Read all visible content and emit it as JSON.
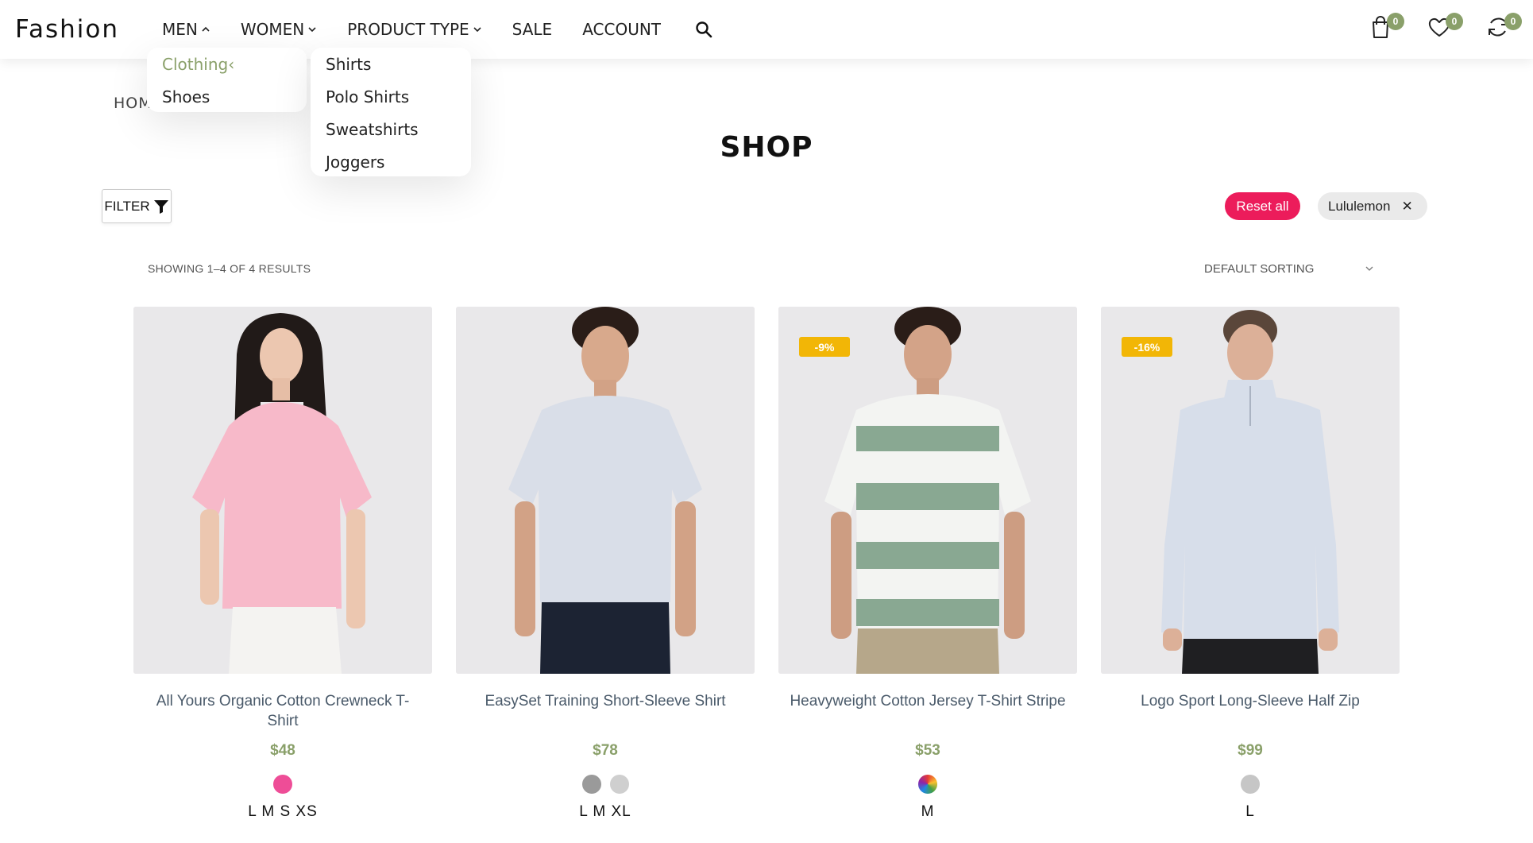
{
  "header": {
    "logo": "Fashion",
    "nav": [
      {
        "label": "MEN",
        "chevron": "up"
      },
      {
        "label": "WOMEN",
        "chevron": "down"
      },
      {
        "label": "PRODUCT TYPE",
        "chevron": "down"
      },
      {
        "label": "SALE"
      },
      {
        "label": "ACCOUNT"
      }
    ],
    "icons": {
      "cart_count": "0",
      "wishlist_count": "0",
      "compare_count": "0"
    }
  },
  "menu": {
    "categories": [
      {
        "label": "Clothing",
        "suffix": "‹",
        "active": true
      },
      {
        "label": "Shoes"
      }
    ],
    "subcategories": [
      "Shirts",
      "Polo Shirts",
      "Sweatshirts",
      "Joggers"
    ]
  },
  "breadcrumb": "HOM",
  "page_title": "SHOP",
  "toolbar": {
    "filter_label": "FILTER",
    "reset_label": "Reset all",
    "active_filter": "Lululemon",
    "results_text": "SHOWING 1–4 OF 4 RESULTS",
    "sorting_label": "DEFAULT SORTING"
  },
  "colors": {
    "accent": "#8aa06a",
    "reset": "#ec1c5b",
    "sale_badge": "#f2b606"
  },
  "products": [
    {
      "title": "All Yours Organic Cotton Crewneck T-Shirt",
      "price": "$48",
      "badge": "",
      "swatches": [
        "#ee4d97"
      ],
      "sizes": "L M S XS"
    },
    {
      "title": "EasySet Training Short-Sleeve Shirt",
      "price": "$78",
      "badge": "",
      "swatches": [
        "#9a9a9a",
        "#cfcfcf"
      ],
      "sizes": "L M XL"
    },
    {
      "title": "Heavyweight Cotton Jersey T-Shirt Stripe",
      "price": "$53",
      "badge": "-9%",
      "swatches": [
        "multicolor"
      ],
      "sizes": "M"
    },
    {
      "title": "Logo Sport Long-Sleeve Half Zip",
      "price": "$99",
      "badge": "-16%",
      "swatches": [
        "#c6c6c6"
      ],
      "sizes": "L"
    }
  ]
}
